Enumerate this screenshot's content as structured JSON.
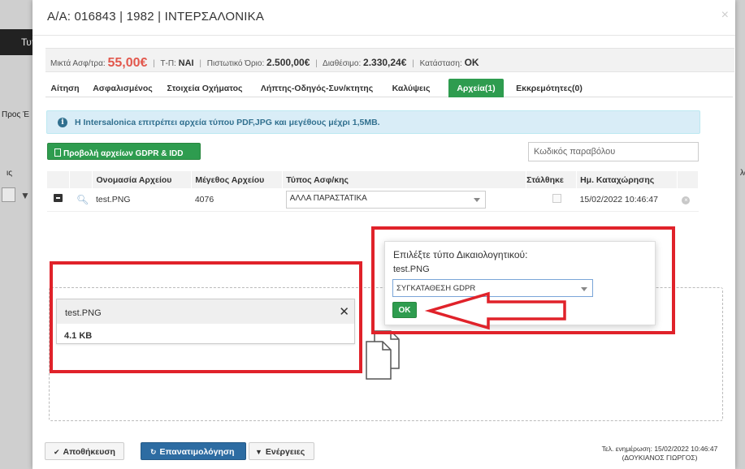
{
  "background": {
    "top_bar_text": "Τυπ",
    "left_text_1": "Προς Έ",
    "left_text_2": "ις",
    "right_text": "λό"
  },
  "modal": {
    "title": "Α/Α: 016843 | 1982 | ΙΝΤΕΡΣΑΛΟΝΙΚΑ",
    "close": "×"
  },
  "infobar": {
    "gross_premium_label": "Μικτά Ασφ/τρα:",
    "gross_premium_value": "55,00€",
    "tp_label": "Τ-Π:",
    "tp_value": "ΝΑΙ",
    "credit_label": "Πιστωτικό Όριο:",
    "credit_value": "2.500,00€",
    "available_label": "Διαθέσιμο:",
    "available_value": "2.330,24€",
    "status_label": "Κατάσταση:",
    "status_value": "OK"
  },
  "tabs": [
    {
      "label": "Αίτηση",
      "active": false
    },
    {
      "label": "Ασφαλισμένος",
      "active": false
    },
    {
      "label": "Στοιχεία Οχήματος",
      "active": false
    },
    {
      "label": "Λήπτης-Οδηγός-Συν/κτητης",
      "active": false
    },
    {
      "label": "Καλύψεις",
      "active": false
    },
    {
      "label": "Αρχεία(1)",
      "active": true
    },
    {
      "label": "Εκκρεμότητες(0)",
      "active": false
    }
  ],
  "alert": {
    "icon": "info-icon",
    "text": "Η Intersalonica επιτρέπει αρχεία τύπου PDF,JPG και μεγέθους μέχρι 1,5MB."
  },
  "gdpr_button": {
    "label": "Προβολή αρχείων GDPR & IDD",
    "icon": "file-pdf-icon"
  },
  "code_input": {
    "placeholder": "Κωδικός παραβόλου",
    "value": ""
  },
  "files_table": {
    "headers": [
      "",
      "",
      "Ονομασία Αρχείου",
      "Μέγεθος Αρχείου",
      "Τύπος Ασφ/κης",
      "Στάλθηκε",
      "Ημ. Καταχώρησης",
      ""
    ],
    "rows": [
      {
        "name": "test.PNG",
        "size": "4076",
        "type": "ΑΛΛΑ ΠΑΡΑΣΤΑΤΙΚΑ",
        "sent": false,
        "date": "15/02/2022 10:46:47"
      }
    ]
  },
  "upload": {
    "file_name": "test.PNG",
    "file_size": "4.1 KB",
    "remove": "✕"
  },
  "popover": {
    "title": "Επιλέξτε τύπο Δικαιολογητικού:",
    "file_name": "test.PNG",
    "selected": "ΣΥΓΚΑΤΑΘΕΣΗ GDPR",
    "ok_label": "OK"
  },
  "annotation_color": "#e0222a",
  "footer": {
    "save_label": "Αποθήκευση",
    "reprice_label": "Επανατιμολόγηση",
    "actions_label": "Ενέργειες",
    "last_update_line1": "Τελ. ενημέρωση: 15/02/2022 10:46:47",
    "last_update_line2": "(ΔΟΥΚΙΑΝΟΣ ΓΙΩΡΓΟΣ)"
  },
  "colors": {
    "accent_green": "#2e9c4f",
    "primary_blue": "#2d6ca2",
    "premium_red": "#e2574c",
    "alert_bg": "#d9edf7"
  }
}
